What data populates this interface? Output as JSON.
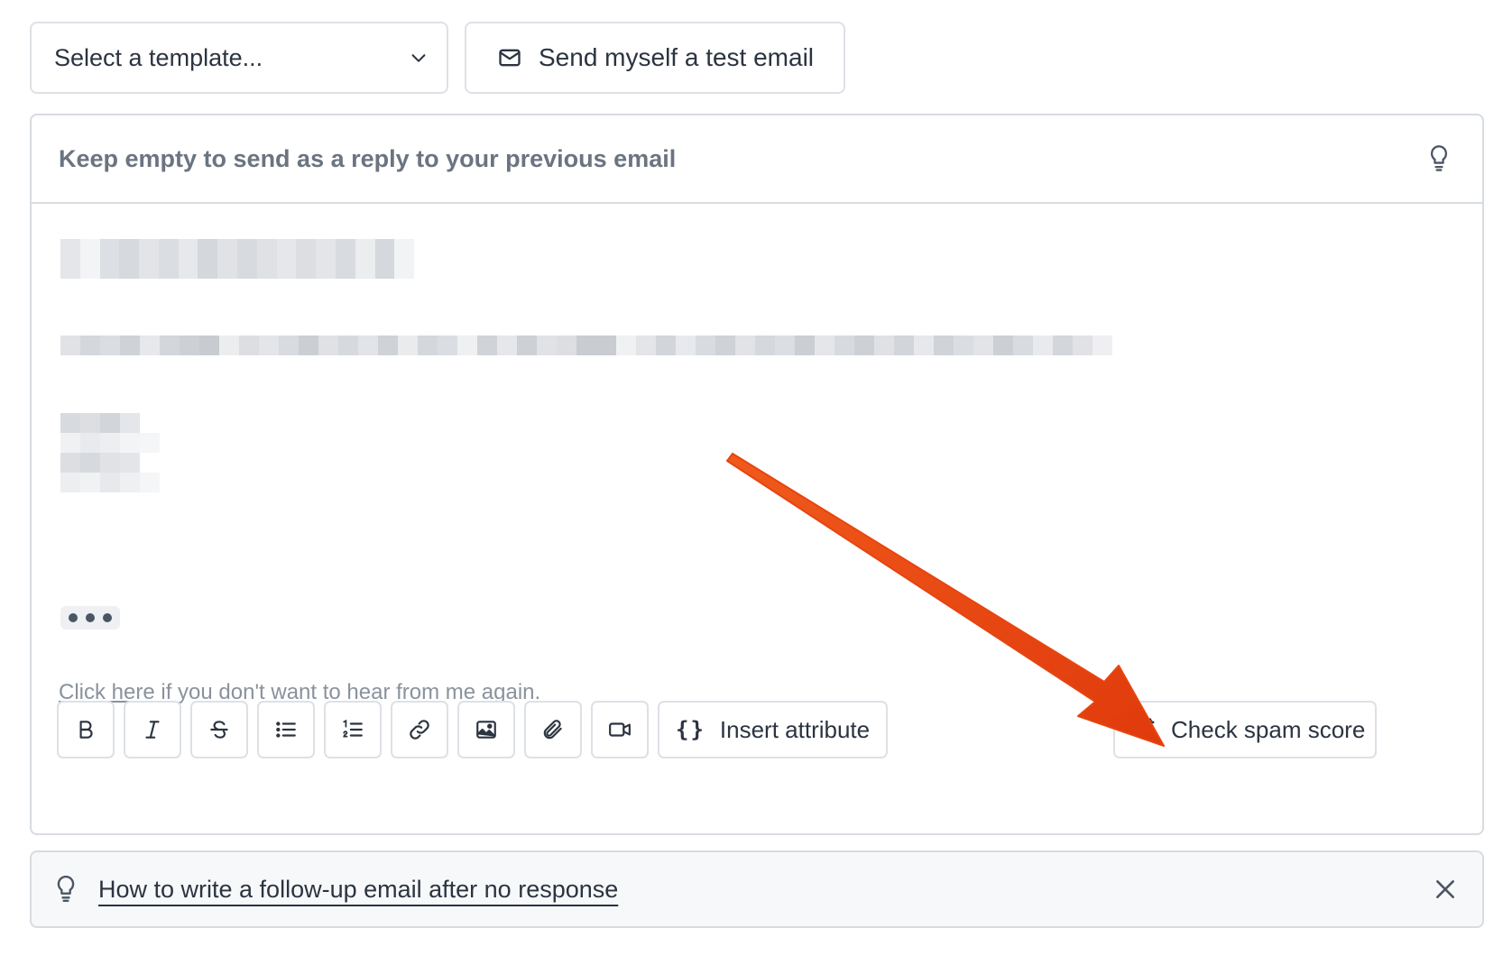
{
  "top_bar": {
    "template_select_value": "Select a template...",
    "test_email_label": "Send myself a test email"
  },
  "subject": {
    "placeholder": "Keep empty to send as a reply to your previous email"
  },
  "body": {
    "more_dots": "•••",
    "unsubscribe_link": "Click here",
    "unsubscribe_text": " if you don't want to hear from me again."
  },
  "toolbar": {
    "tools": [
      "bold",
      "italic",
      "strikethrough",
      "bullet-list",
      "numbered-list",
      "link",
      "image",
      "attachment",
      "video"
    ],
    "insert_attribute_label": "Insert attribute",
    "insert_attribute_glyph": "{}",
    "check_spam_label": "Check spam score"
  },
  "tip": {
    "link_text": "How to write a follow-up email after no response"
  },
  "colors": {
    "arrow": "#e8440f",
    "border": "#d7dce1",
    "text": "#2b3440",
    "muted": "#6b7480"
  }
}
